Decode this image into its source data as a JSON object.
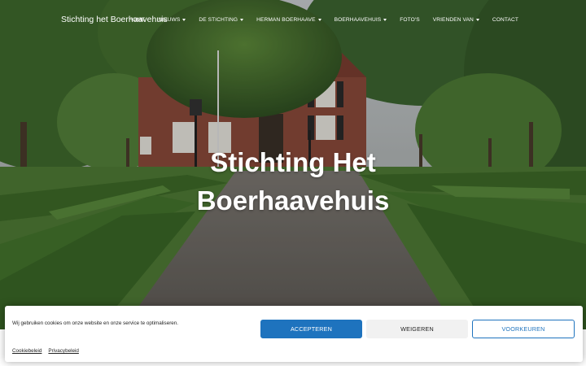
{
  "site": {
    "brand": "Stichting het Boerhaavehuis"
  },
  "nav": {
    "items": [
      {
        "label": "HOME",
        "dropdown": false
      },
      {
        "label": "NIEUWS",
        "dropdown": true
      },
      {
        "label": "DE STICHTING",
        "dropdown": true
      },
      {
        "label": "HERMAN BOERHAAVE",
        "dropdown": true
      },
      {
        "label": "BOERHAAVEHUIS",
        "dropdown": true
      },
      {
        "label": "FOTO'S",
        "dropdown": false
      },
      {
        "label": "VRIENDEN VAN",
        "dropdown": true
      },
      {
        "label": "CONTACT",
        "dropdown": false
      }
    ]
  },
  "hero": {
    "title_line1": "Stichting Het",
    "title_line2": "Boerhaavehuis"
  },
  "cookie": {
    "message": "Wij gebruiken cookies om onze website en onze service te optimaliseren.",
    "accept_label": "ACCEPTEREN",
    "deny_label": "WEIGEREN",
    "prefs_label": "VOORKEUREN",
    "link_cookie_policy": "Cookiebeleid",
    "link_privacy": "Privacybeleid"
  },
  "colors": {
    "accent": "#1e73be",
    "deny_bg": "#f1f1f1"
  }
}
